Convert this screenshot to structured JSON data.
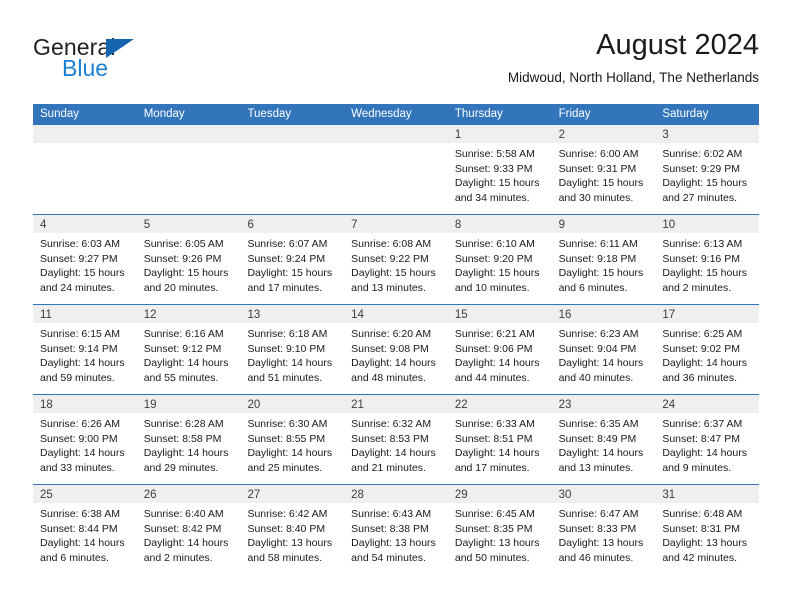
{
  "brand": {
    "name_part1": "General",
    "name_part2": "Blue",
    "triangle_icon": "triangle-icon",
    "color_dark": "#231f20",
    "color_blue": "#1b7fd4"
  },
  "header": {
    "title": "August 2024",
    "subtitle": "Midwoud, North Holland, The Netherlands"
  },
  "theme": {
    "header_bar": "#3275bb",
    "day_band": "#efefef",
    "grid_line": "#3275bb",
    "text": "#1a1a1a"
  },
  "weekdays": [
    "Sunday",
    "Monday",
    "Tuesday",
    "Wednesday",
    "Thursday",
    "Friday",
    "Saturday"
  ],
  "weeks": [
    {
      "days": [
        {
          "num": "",
          "lines": [
            "",
            "",
            "",
            ""
          ]
        },
        {
          "num": "",
          "lines": [
            "",
            "",
            "",
            ""
          ]
        },
        {
          "num": "",
          "lines": [
            "",
            "",
            "",
            ""
          ]
        },
        {
          "num": "",
          "lines": [
            "",
            "",
            "",
            ""
          ]
        },
        {
          "num": "1",
          "lines": [
            "Sunrise: 5:58 AM",
            "Sunset: 9:33 PM",
            "Daylight: 15 hours",
            "and 34 minutes."
          ]
        },
        {
          "num": "2",
          "lines": [
            "Sunrise: 6:00 AM",
            "Sunset: 9:31 PM",
            "Daylight: 15 hours",
            "and 30 minutes."
          ]
        },
        {
          "num": "3",
          "lines": [
            "Sunrise: 6:02 AM",
            "Sunset: 9:29 PM",
            "Daylight: 15 hours",
            "and 27 minutes."
          ]
        }
      ]
    },
    {
      "days": [
        {
          "num": "4",
          "lines": [
            "Sunrise: 6:03 AM",
            "Sunset: 9:27 PM",
            "Daylight: 15 hours",
            "and 24 minutes."
          ]
        },
        {
          "num": "5",
          "lines": [
            "Sunrise: 6:05 AM",
            "Sunset: 9:26 PM",
            "Daylight: 15 hours",
            "and 20 minutes."
          ]
        },
        {
          "num": "6",
          "lines": [
            "Sunrise: 6:07 AM",
            "Sunset: 9:24 PM",
            "Daylight: 15 hours",
            "and 17 minutes."
          ]
        },
        {
          "num": "7",
          "lines": [
            "Sunrise: 6:08 AM",
            "Sunset: 9:22 PM",
            "Daylight: 15 hours",
            "and 13 minutes."
          ]
        },
        {
          "num": "8",
          "lines": [
            "Sunrise: 6:10 AM",
            "Sunset: 9:20 PM",
            "Daylight: 15 hours",
            "and 10 minutes."
          ]
        },
        {
          "num": "9",
          "lines": [
            "Sunrise: 6:11 AM",
            "Sunset: 9:18 PM",
            "Daylight: 15 hours",
            "and 6 minutes."
          ]
        },
        {
          "num": "10",
          "lines": [
            "Sunrise: 6:13 AM",
            "Sunset: 9:16 PM",
            "Daylight: 15 hours",
            "and 2 minutes."
          ]
        }
      ]
    },
    {
      "days": [
        {
          "num": "11",
          "lines": [
            "Sunrise: 6:15 AM",
            "Sunset: 9:14 PM",
            "Daylight: 14 hours",
            "and 59 minutes."
          ]
        },
        {
          "num": "12",
          "lines": [
            "Sunrise: 6:16 AM",
            "Sunset: 9:12 PM",
            "Daylight: 14 hours",
            "and 55 minutes."
          ]
        },
        {
          "num": "13",
          "lines": [
            "Sunrise: 6:18 AM",
            "Sunset: 9:10 PM",
            "Daylight: 14 hours",
            "and 51 minutes."
          ]
        },
        {
          "num": "14",
          "lines": [
            "Sunrise: 6:20 AM",
            "Sunset: 9:08 PM",
            "Daylight: 14 hours",
            "and 48 minutes."
          ]
        },
        {
          "num": "15",
          "lines": [
            "Sunrise: 6:21 AM",
            "Sunset: 9:06 PM",
            "Daylight: 14 hours",
            "and 44 minutes."
          ]
        },
        {
          "num": "16",
          "lines": [
            "Sunrise: 6:23 AM",
            "Sunset: 9:04 PM",
            "Daylight: 14 hours",
            "and 40 minutes."
          ]
        },
        {
          "num": "17",
          "lines": [
            "Sunrise: 6:25 AM",
            "Sunset: 9:02 PM",
            "Daylight: 14 hours",
            "and 36 minutes."
          ]
        }
      ]
    },
    {
      "days": [
        {
          "num": "18",
          "lines": [
            "Sunrise: 6:26 AM",
            "Sunset: 9:00 PM",
            "Daylight: 14 hours",
            "and 33 minutes."
          ]
        },
        {
          "num": "19",
          "lines": [
            "Sunrise: 6:28 AM",
            "Sunset: 8:58 PM",
            "Daylight: 14 hours",
            "and 29 minutes."
          ]
        },
        {
          "num": "20",
          "lines": [
            "Sunrise: 6:30 AM",
            "Sunset: 8:55 PM",
            "Daylight: 14 hours",
            "and 25 minutes."
          ]
        },
        {
          "num": "21",
          "lines": [
            "Sunrise: 6:32 AM",
            "Sunset: 8:53 PM",
            "Daylight: 14 hours",
            "and 21 minutes."
          ]
        },
        {
          "num": "22",
          "lines": [
            "Sunrise: 6:33 AM",
            "Sunset: 8:51 PM",
            "Daylight: 14 hours",
            "and 17 minutes."
          ]
        },
        {
          "num": "23",
          "lines": [
            "Sunrise: 6:35 AM",
            "Sunset: 8:49 PM",
            "Daylight: 14 hours",
            "and 13 minutes."
          ]
        },
        {
          "num": "24",
          "lines": [
            "Sunrise: 6:37 AM",
            "Sunset: 8:47 PM",
            "Daylight: 14 hours",
            "and 9 minutes."
          ]
        }
      ]
    },
    {
      "days": [
        {
          "num": "25",
          "lines": [
            "Sunrise: 6:38 AM",
            "Sunset: 8:44 PM",
            "Daylight: 14 hours",
            "and 6 minutes."
          ]
        },
        {
          "num": "26",
          "lines": [
            "Sunrise: 6:40 AM",
            "Sunset: 8:42 PM",
            "Daylight: 14 hours",
            "and 2 minutes."
          ]
        },
        {
          "num": "27",
          "lines": [
            "Sunrise: 6:42 AM",
            "Sunset: 8:40 PM",
            "Daylight: 13 hours",
            "and 58 minutes."
          ]
        },
        {
          "num": "28",
          "lines": [
            "Sunrise: 6:43 AM",
            "Sunset: 8:38 PM",
            "Daylight: 13 hours",
            "and 54 minutes."
          ]
        },
        {
          "num": "29",
          "lines": [
            "Sunrise: 6:45 AM",
            "Sunset: 8:35 PM",
            "Daylight: 13 hours",
            "and 50 minutes."
          ]
        },
        {
          "num": "30",
          "lines": [
            "Sunrise: 6:47 AM",
            "Sunset: 8:33 PM",
            "Daylight: 13 hours",
            "and 46 minutes."
          ]
        },
        {
          "num": "31",
          "lines": [
            "Sunrise: 6:48 AM",
            "Sunset: 8:31 PM",
            "Daylight: 13 hours",
            "and 42 minutes."
          ]
        }
      ]
    }
  ]
}
